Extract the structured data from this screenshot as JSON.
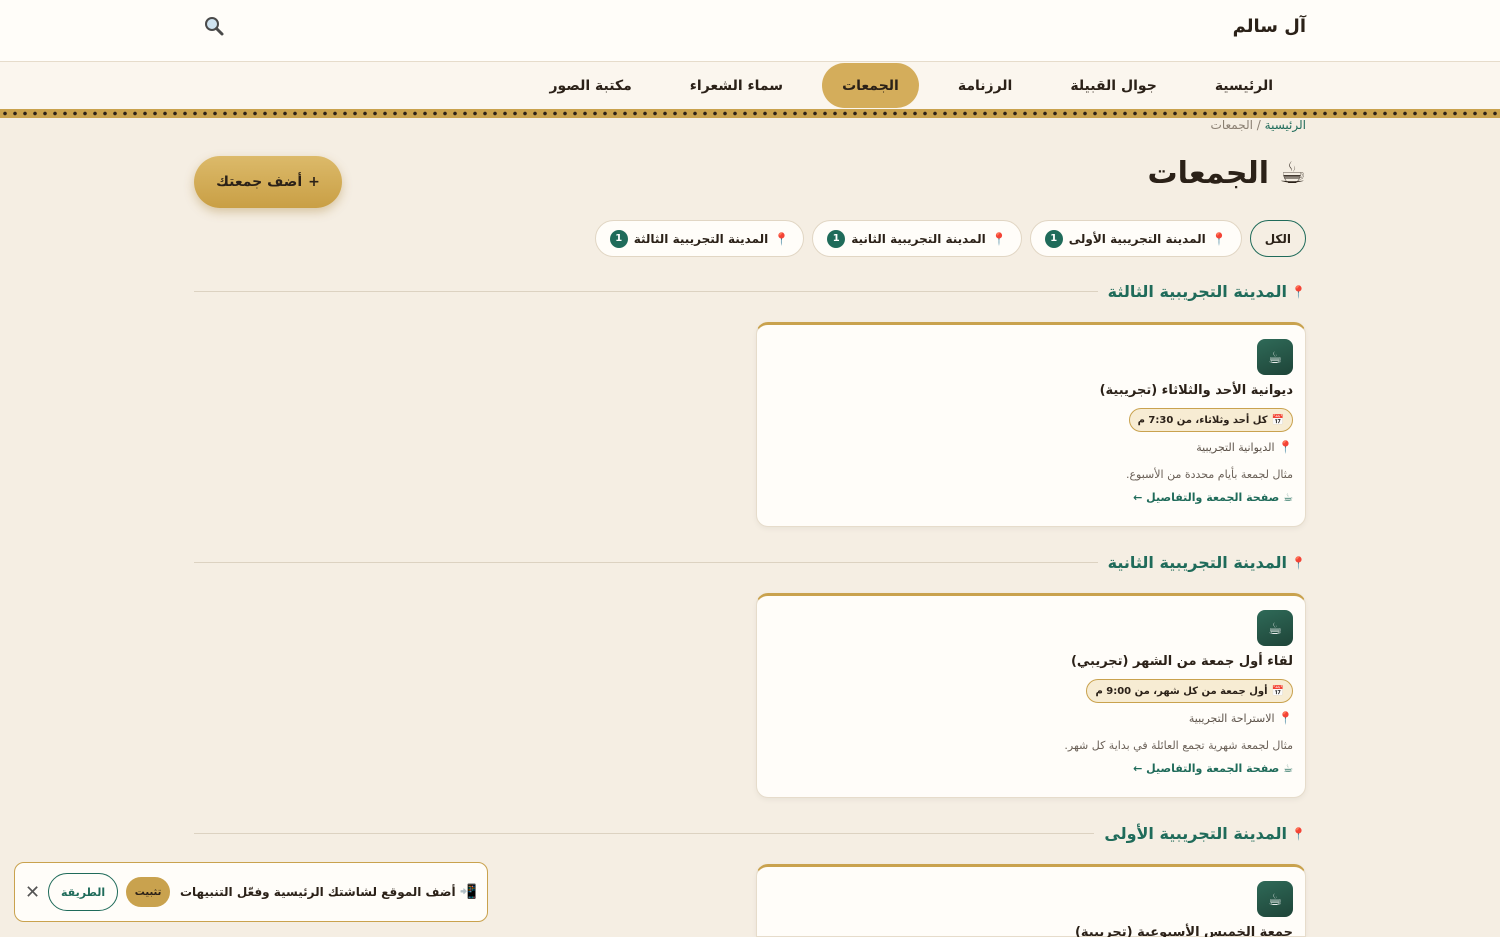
{
  "header": {
    "site_name": "آل سالم",
    "search_icon": "search-icon"
  },
  "nav": {
    "items": [
      {
        "label": "الرئيسية",
        "active": false
      },
      {
        "label": "جوال القبيلة",
        "active": false
      },
      {
        "label": "الرزنامة",
        "active": false
      },
      {
        "label": "الجمعات",
        "active": true
      },
      {
        "label": "سماء الشعراء",
        "active": false
      },
      {
        "label": "مكتبة الصور",
        "active": false
      }
    ]
  },
  "breadcrumb": {
    "home": "الرئيسية",
    "separator": "/",
    "current": "الجمعات"
  },
  "page": {
    "title_icon": "☕",
    "title": "الجمعات",
    "add_button_icon": "+",
    "add_button_label": "أضف جمعتك"
  },
  "filters": [
    {
      "label": "الكل",
      "count": null,
      "selected": true
    },
    {
      "label": "المدينة التجريبية الأولى",
      "count": "1",
      "selected": false
    },
    {
      "label": "المدينة التجريبية الثانية",
      "count": "1",
      "selected": false
    },
    {
      "label": "المدينة التجريبية الثالثة",
      "count": "1",
      "selected": false
    }
  ],
  "sections": [
    {
      "title": "المدينة التجريبية الثالثة",
      "card": {
        "icon": "☕",
        "name": "ديوانية الأحد والثلاثاء (تجريبية)",
        "schedule": "كل أحد وثلاثاء، من 7:30 م",
        "place": "الديوانية التجريبية",
        "desc": "مثال لجمعة بأيام محددة من الأسبوع.",
        "link": "صفحة الجمعة والتفاصيل ←"
      }
    },
    {
      "title": "المدينة التجريبية الثانية",
      "card": {
        "icon": "☕",
        "name": "لقاء أول جمعة من الشهر (تجريبي)",
        "schedule": "أول جمعة من كل شهر، من 9:00 م",
        "place": "الاستراحة التجريبية",
        "desc": "مثال لجمعة شهرية تجمع العائلة في بداية كل شهر.",
        "link": "صفحة الجمعة والتفاصيل ←"
      }
    },
    {
      "title": "المدينة التجريبية الأولى",
      "card": {
        "icon": "☕",
        "name": "جمعة الخميس الأسبوعية (تجريبية)"
      }
    }
  ],
  "install_banner": {
    "icon": "📲",
    "message": "أضف الموقع لشاشتك الرئيسية وفعّل التنبيهات",
    "install_label": "تثبيت",
    "how_label": "الطريقة",
    "close": "✕"
  },
  "colors": {
    "accent_gold": "#c9a24e",
    "primary_green": "#1f6b5a",
    "background": "#f5eee3"
  }
}
